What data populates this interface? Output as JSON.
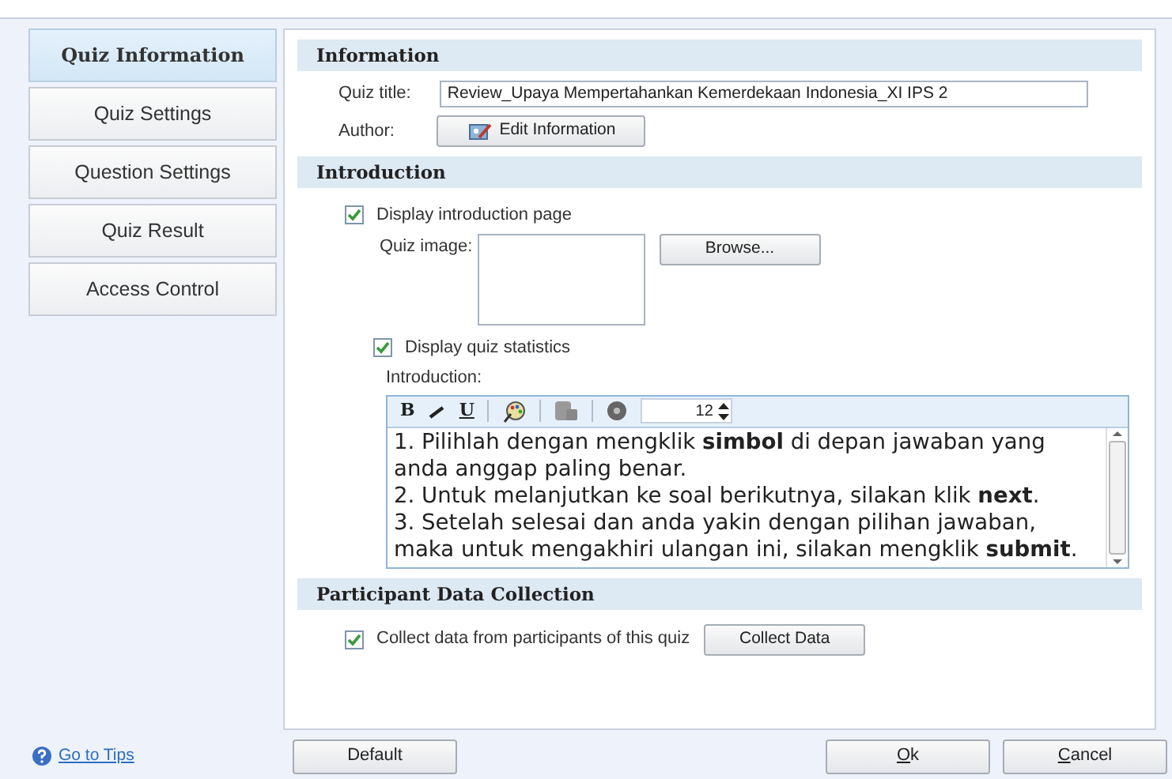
{
  "sidebar": {
    "items": [
      {
        "label": "Quiz Information",
        "selected": true
      },
      {
        "label": "Quiz Settings",
        "selected": false
      },
      {
        "label": "Question Settings",
        "selected": false
      },
      {
        "label": "Quiz Result",
        "selected": false
      },
      {
        "label": "Access Control",
        "selected": false
      }
    ]
  },
  "information": {
    "header": "Information",
    "quiz_title_label": "Quiz title:",
    "quiz_title": "Review_Upaya Mempertahankan Kemerdekaan Indonesia_XI IPS 2",
    "author_label": "Author:",
    "edit_button": "Edit Information"
  },
  "introduction": {
    "header": "Introduction",
    "display_intro": {
      "label": "Display introduction page",
      "checked": true
    },
    "image_label": "Quiz image:",
    "browse_button": "Browse...",
    "display_stats": {
      "label": "Display quiz statistics",
      "checked": true
    },
    "intro_label": "Introduction:",
    "toolbar": {
      "bold": "B",
      "underline": "U",
      "font_size": "12"
    },
    "paragraphs": [
      "1. Pilihlah dengan mengklik **simbol** di depan jawaban yang anda anggap paling benar.",
      "2. Untuk melanjutkan ke soal berikutnya, silakan klik **next**.",
      "3. Setelah selesai dan anda yakin dengan pilihan jawaban, maka untuk mengakhiri ulangan ini, silakan mengklik **submit**."
    ]
  },
  "participant": {
    "header": "Participant Data Collection",
    "collect": {
      "label": "Collect data from participants of this quiz",
      "checked": true
    },
    "collect_button": "Collect Data"
  },
  "footer": {
    "tips_link": "Go to Tips",
    "buttons": [
      {
        "label": "Default",
        "mnemonic": false
      },
      {
        "label": "Ok",
        "mnemonic": true
      },
      {
        "label": "Cancel",
        "mnemonic": true
      }
    ]
  }
}
